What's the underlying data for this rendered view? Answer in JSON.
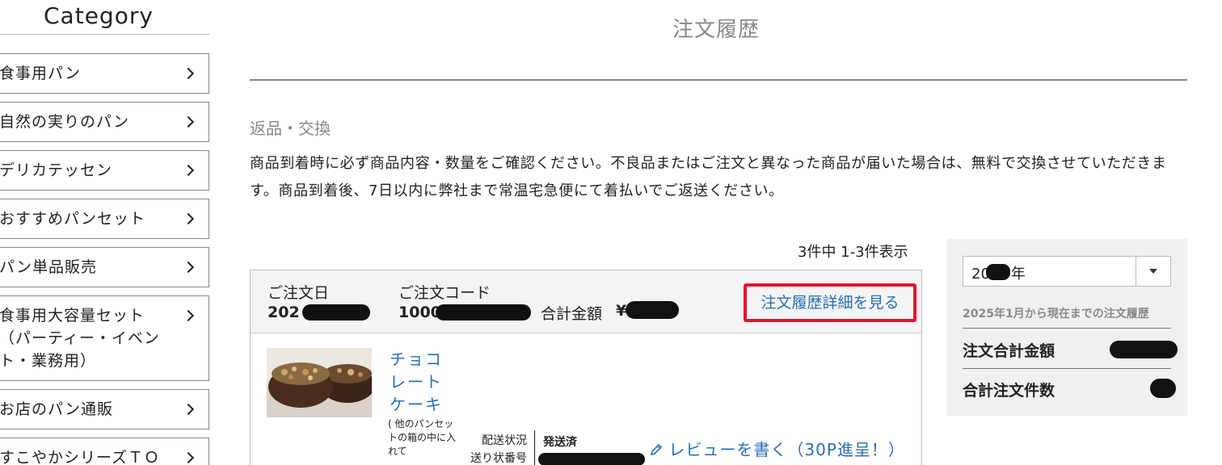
{
  "sidebar": {
    "title": "Category",
    "items": [
      {
        "label": "食事用パン"
      },
      {
        "label": "自然の実りのパン"
      },
      {
        "label": "デリカテッセン"
      },
      {
        "label": "おすすめパンセット"
      },
      {
        "label": "パン単品販売"
      },
      {
        "label": "食事用大容量セット\n（パーティー・イベン\nト・業務用）"
      },
      {
        "label": "お店のパン通販"
      },
      {
        "label": "すこやかシリーズＴＯ"
      }
    ]
  },
  "main": {
    "title": "注文履歴",
    "section_heading": "返品・交換",
    "notice": "商品到着時に必ず商品内容・数量をご確認ください。不良品またはご注文と異なった商品が届いた場合は、無料で交換させていただきます。商品到着後、7日以内に弊社まで常温宅急便にて着払いでご返送ください。",
    "result_count": "3件中 1-3件表示"
  },
  "order": {
    "date_label": "ご注文日",
    "date_value": "202",
    "code_label": "ご注文コード",
    "code_value": "1000",
    "total_label": "合計金額",
    "total_value": "¥",
    "detail_link": "注文履歴詳細を見る",
    "product_name": "チョコレートケーキ",
    "product_note": "( 他のパンセットの箱の中に入れて",
    "shipping_status_label": "配送状況",
    "tracking_label": "送り状番号",
    "shipping_status": "発送済",
    "review_link": "レビューを書く（30P進呈！）",
    "highlight_color": "#e8102e",
    "link_color": "#2a6fb6"
  },
  "summary": {
    "year_value": "20",
    "year_suffix": "年",
    "range_note": "2025年1月から現在までの注文履歴",
    "total_amount_label": "注文合計金額",
    "total_count_label": "合計注文件数"
  }
}
